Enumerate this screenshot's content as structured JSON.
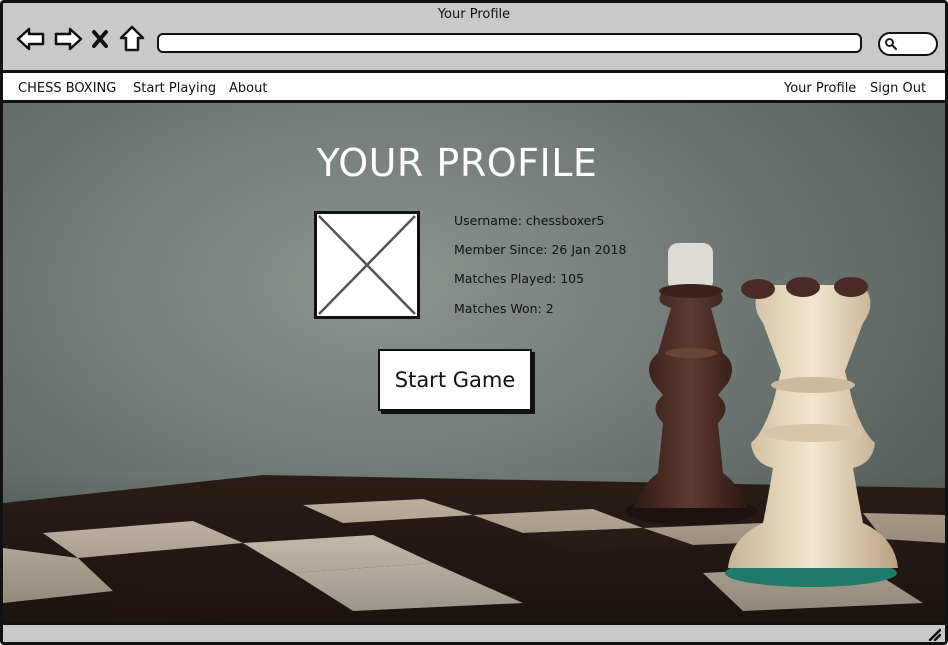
{
  "window": {
    "title": "Your Profile"
  },
  "toolbar": {
    "back_icon": "arrow-left-icon",
    "forward_icon": "arrow-right-icon",
    "close_icon": "x-icon",
    "home_icon": "home-icon",
    "address_value": "",
    "search_icon": "search-icon"
  },
  "menu": {
    "brand": "CHESS BOXING",
    "left_items": [
      "Start Playing",
      "About"
    ],
    "right_items": [
      "Your Profile",
      "Sign Out"
    ]
  },
  "profile": {
    "heading": "YOUR PROFILE",
    "username": "Username: chessboxer5",
    "member_since": "Member Since: 26 Jan 2018",
    "matches_played": "Matches Played: 105",
    "matches_won": "Matches Won: 2",
    "start_button": "Start Game"
  },
  "colors": {
    "chrome": "#c9c9c9",
    "background": "#6e7773",
    "dark_king": "#4a2c24",
    "light_queen": "#e8d9bf"
  }
}
